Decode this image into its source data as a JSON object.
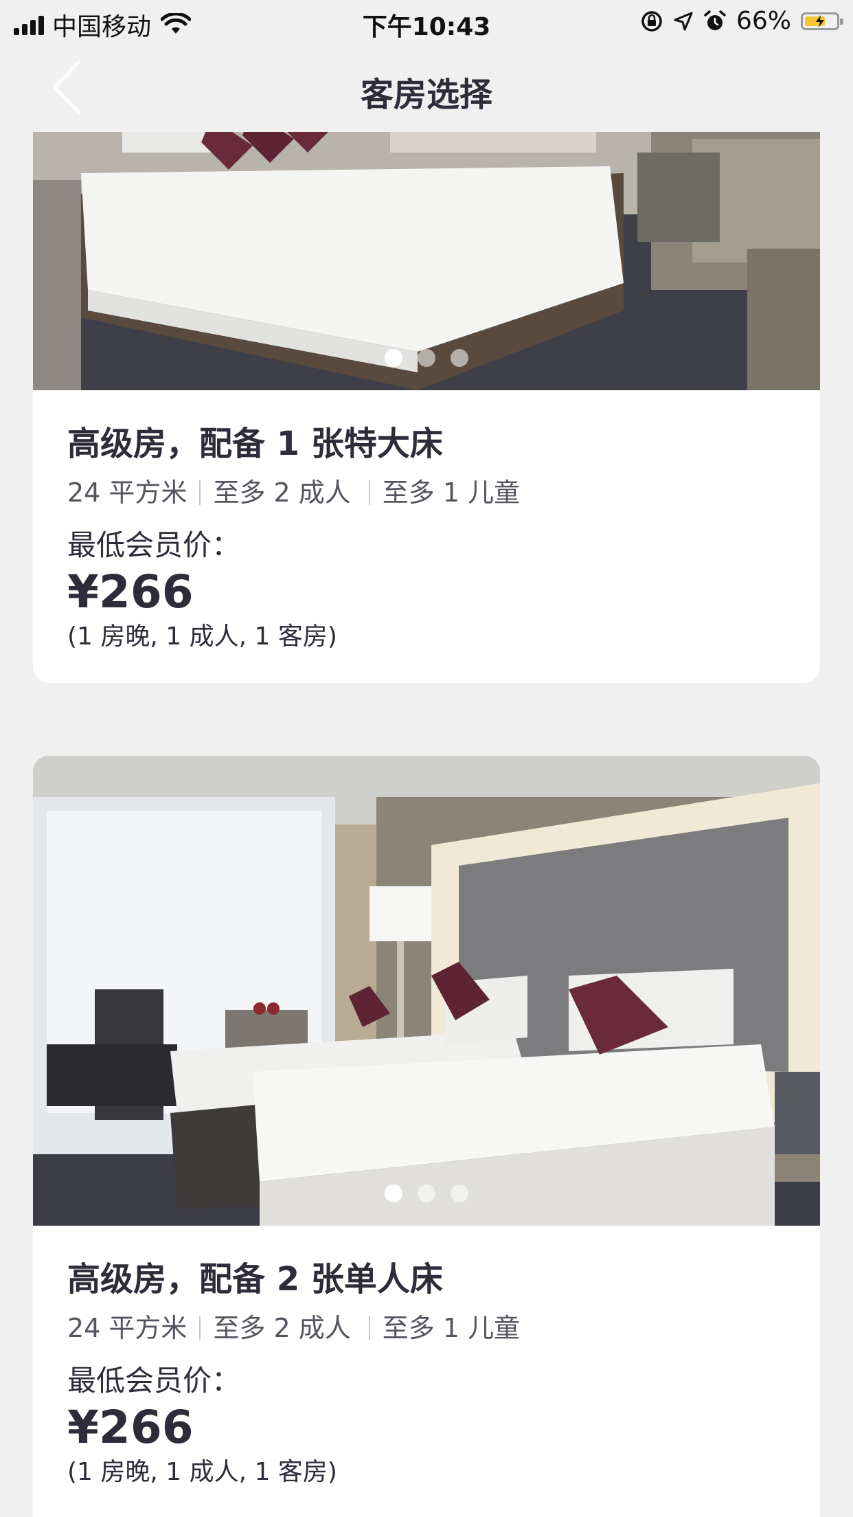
{
  "status_bar": {
    "carrier": "中国移动",
    "time": "下午10:43",
    "battery_percent": "66%",
    "battery_level": 0.66,
    "icons": [
      "signal-icon",
      "wifi-icon",
      "orientation-lock-icon",
      "location-icon",
      "alarm-icon",
      "battery-icon"
    ]
  },
  "nav": {
    "title": "客房选择",
    "back_icon": "chevron-left-icon"
  },
  "rooms": [
    {
      "name": "高级房，配备 1 张特大床",
      "area": "24 平方米",
      "adults": "至多 2 成人",
      "children": "至多 1 儿童",
      "price_label": "最低会员价：",
      "price": "¥266",
      "price_note": "(1 房晚, 1 成人, 1 客房)",
      "photo_count": 3,
      "active_photo": 1
    },
    {
      "name": "高级房，配备 2 张单人床",
      "area": "24 平方米",
      "adults": "至多 2 成人",
      "children": "至多 1 儿童",
      "price_label": "最低会员价：",
      "price": "¥266",
      "price_note": "(1 房晚, 1 成人, 1 客房)",
      "photo_count": 3,
      "active_photo": 1
    }
  ],
  "colors": {
    "background": "#f0f0f0",
    "text_primary": "#2e2c3a",
    "text_secondary": "#55535e",
    "card": "#ffffff",
    "battery_fill": "#f4c531"
  }
}
